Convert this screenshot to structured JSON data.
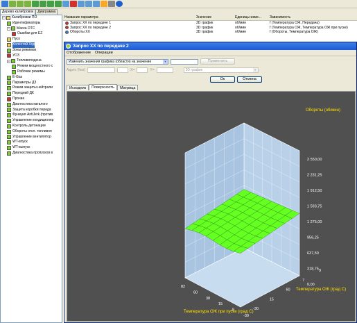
{
  "left_tabs": [
    "Дерево калибровок",
    "Диаграмма"
  ],
  "tree": [
    {
      "label": "Калибровки ПО",
      "icon": "folder",
      "indent": 0,
      "expander": "-"
    },
    {
      "label": "Идентификаторы",
      "icon": "green",
      "indent": 1
    },
    {
      "label": "Маска DTC",
      "icon": "green",
      "indent": 1,
      "expander": "-"
    },
    {
      "label": "Ошибки для EZ",
      "icon": "red",
      "indent": 2
    },
    {
      "label": "Пуск",
      "icon": "yellow",
      "indent": 1
    },
    {
      "label": "Холостой Ход",
      "icon": "yellow",
      "indent": 1,
      "selected": true
    },
    {
      "label": "Зоны режимов",
      "icon": "green",
      "indent": 1
    },
    {
      "label": "УОЗ",
      "icon": "red",
      "indent": 1
    },
    {
      "label": "Топливоподача",
      "icon": "green",
      "indent": 1,
      "expander": "-"
    },
    {
      "label": "Режим мощностного с",
      "icon": "green",
      "indent": 2
    },
    {
      "label": "Рабочие режимы",
      "icon": "green",
      "indent": 2
    },
    {
      "label": "E-Gas",
      "icon": "green",
      "indent": 1
    },
    {
      "label": "Параметры ДЗ",
      "icon": "green",
      "indent": 1
    },
    {
      "label": "Режим защиты нейтрали",
      "icon": "green",
      "indent": 1
    },
    {
      "label": "Передний ДК",
      "icon": "green",
      "indent": 1
    },
    {
      "label": "Прочие",
      "icon": "red",
      "indent": 1
    },
    {
      "label": "Диагностика каталого",
      "icon": "green",
      "indent": 1
    },
    {
      "label": "Защита коробки переда",
      "icon": "green",
      "indent": 1
    },
    {
      "label": "Функция AntiJerk (против",
      "icon": "green",
      "indent": 1
    },
    {
      "label": "Управление кондиционер",
      "icon": "green",
      "indent": 1
    },
    {
      "label": "Контроль детонации",
      "icon": "green",
      "indent": 1
    },
    {
      "label": "Обороты откл. топливоп",
      "icon": "green",
      "indent": 1
    },
    {
      "label": "Управление вентилятор",
      "icon": "green",
      "indent": 1
    },
    {
      "label": "WT-впуск",
      "icon": "green",
      "indent": 1
    },
    {
      "label": "WT-выпуск",
      "icon": "green",
      "indent": 1
    },
    {
      "label": "Диагностика пропусков в",
      "icon": "green",
      "indent": 1
    }
  ],
  "table": {
    "headers": [
      "Название параметра",
      "Значение",
      "Единицы изме...",
      "Зависимость"
    ],
    "rows": [
      [
        "Запрос XX по передаче 1",
        "3D график",
        "об/мин",
        "f (Температура ОЖ, Передача)"
      ],
      [
        "Запрос XX по передаче 2",
        "3D график",
        "об/мин",
        "f (Температура ОЖ, Температура ОЖ при пуске)"
      ],
      [
        "Обороты XX",
        "3D график",
        "об/мин",
        "f (Обороты, Температура ОЖ)"
      ]
    ]
  },
  "dialog": {
    "title": "Запрос XX по передаче 2",
    "menu": [
      "Отображение",
      "Операции"
    ],
    "mode_select": "Изменить значения графика (области) на значение",
    "apply_button": "Применить",
    "addr_label": "Адрес (hex)",
    "x_label": "X=",
    "y_label": "Y=",
    "graph_type_select": "3D график",
    "ok_button": "Ок",
    "cancel_button": "Отмена",
    "tabs": [
      "Исходник",
      "Поверхность",
      "Матрица"
    ],
    "active_tab": "Поверхность"
  },
  "chart_data": {
    "type": "surface3d",
    "title": "",
    "zlabel": "Обороты (об/мин)",
    "xlabel": "Температура ОЖ при пуске (град С)",
    "ylabel": "Температура ОЖ (град С)",
    "z_ticks": [
      "2 550,00",
      "2 231,25",
      "1 912,50",
      "1 593,75",
      "1 275,00",
      "956,25",
      "637,50",
      "318,75",
      "0,00"
    ],
    "x_ticks": [
      "82",
      "60",
      "38",
      "15",
      "-8",
      "-30"
    ],
    "y_ticks": [
      "-30",
      "15",
      "60",
      "7",
      "9"
    ],
    "zlim": [
      0,
      2550
    ],
    "surface_range": [
      950,
      1300
    ]
  }
}
